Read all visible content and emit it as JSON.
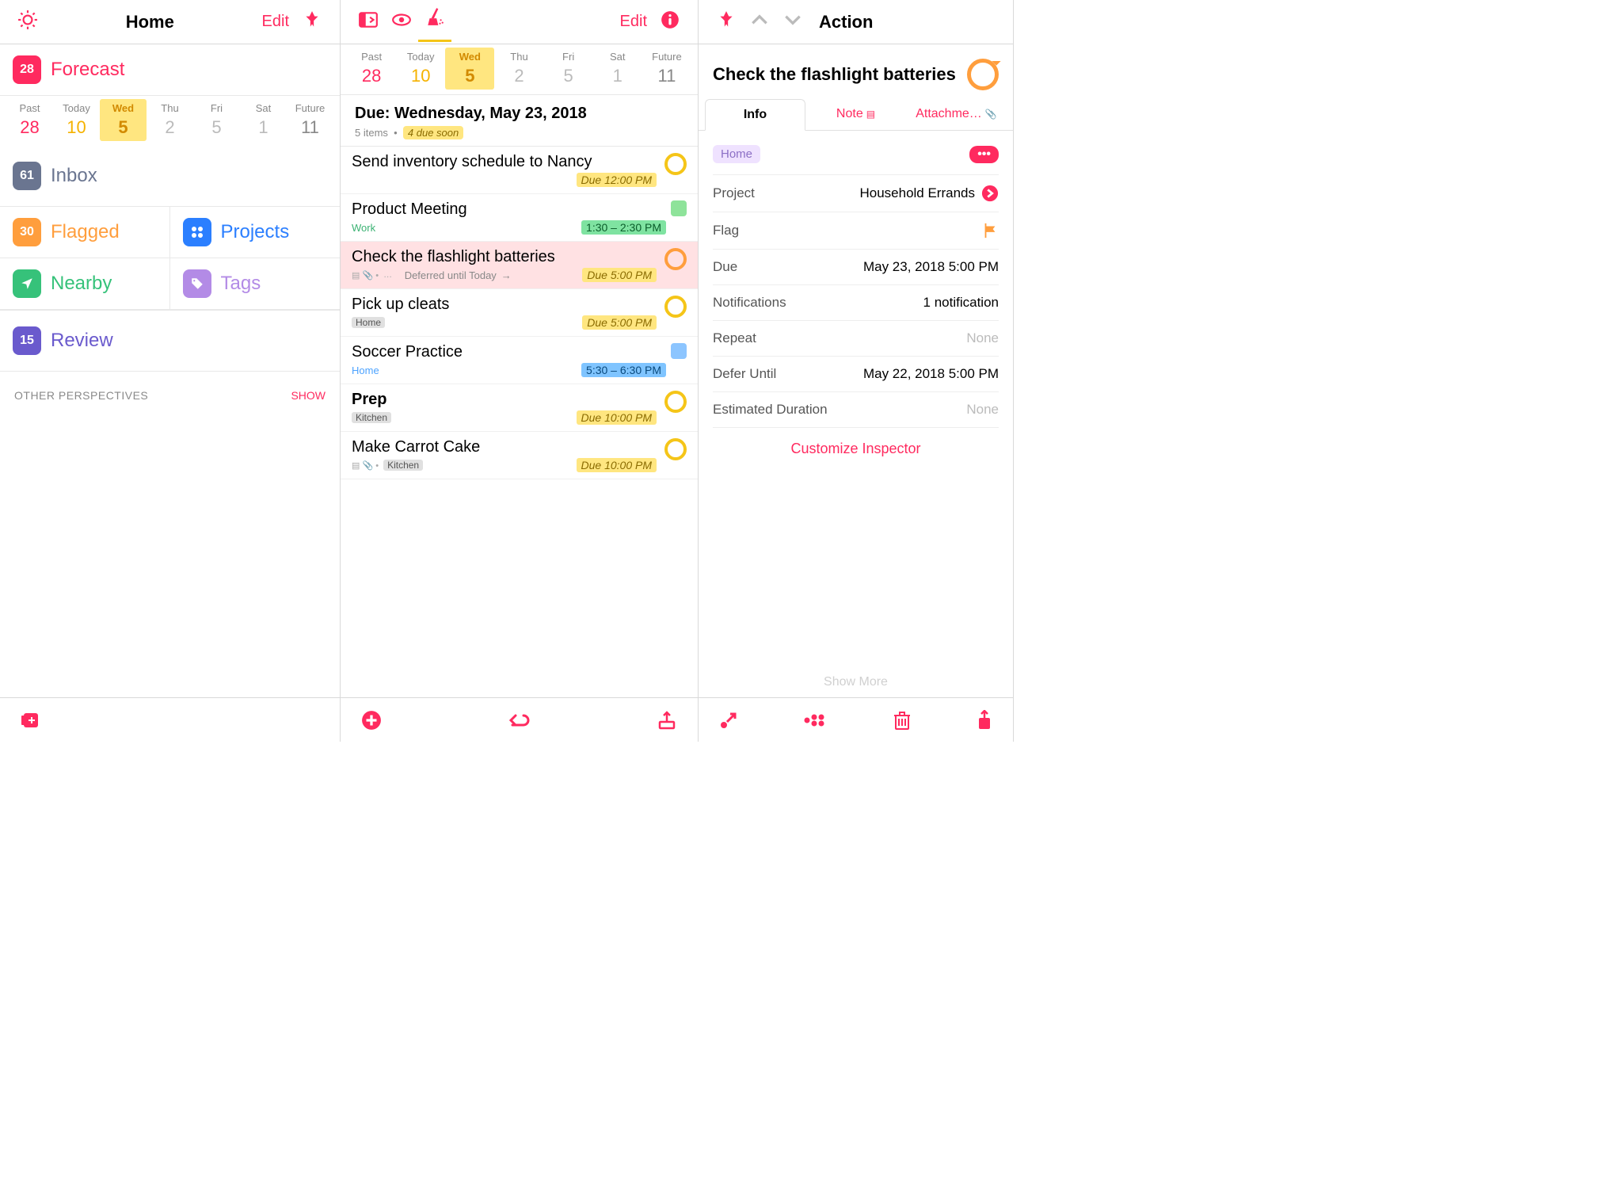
{
  "left": {
    "title": "Home",
    "edit": "Edit",
    "forecast": {
      "num": "28",
      "label": "Forecast"
    },
    "days": [
      {
        "lbl": "Past",
        "num": "28",
        "cls": "past"
      },
      {
        "lbl": "Today",
        "num": "10",
        "cls": "today"
      },
      {
        "lbl": "Wed",
        "num": "5",
        "cls": "sel"
      },
      {
        "lbl": "Thu",
        "num": "2",
        "cls": ""
      },
      {
        "lbl": "Fri",
        "num": "5",
        "cls": ""
      },
      {
        "lbl": "Sat",
        "num": "1",
        "cls": ""
      },
      {
        "lbl": "Future",
        "num": "11",
        "cls": "future"
      }
    ],
    "inbox": {
      "num": "61",
      "label": "Inbox"
    },
    "flagged": {
      "num": "30",
      "label": "Flagged"
    },
    "projects": {
      "label": "Projects"
    },
    "nearby": {
      "label": "Nearby"
    },
    "tags": {
      "label": "Tags"
    },
    "review": {
      "num": "15",
      "label": "Review"
    },
    "other_label": "OTHER PERSPECTIVES",
    "show": "SHOW"
  },
  "mid": {
    "edit": "Edit",
    "days": [
      {
        "lbl": "Past",
        "num": "28",
        "cls": "past"
      },
      {
        "lbl": "Today",
        "num": "10",
        "cls": "today"
      },
      {
        "lbl": "Wed",
        "num": "5",
        "cls": "sel"
      },
      {
        "lbl": "Thu",
        "num": "2",
        "cls": ""
      },
      {
        "lbl": "Fri",
        "num": "5",
        "cls": ""
      },
      {
        "lbl": "Sat",
        "num": "1",
        "cls": ""
      },
      {
        "lbl": "Future",
        "num": "11",
        "cls": "future"
      }
    ],
    "header_title": "Due: Wednesday, May 23, 2018",
    "header_count": "5 items",
    "header_due": "4 due soon",
    "tasks": [
      {
        "title": "Send inventory schedule to Nancy",
        "sub": "",
        "due": "Due 12:00 PM",
        "dueCls": "due-yel",
        "circle": "",
        "tagTxt": "",
        "tagCls": ""
      },
      {
        "title": "Product Meeting",
        "sub": "Work",
        "subCls": "tag-green",
        "due": "1:30 – 2:30 PM",
        "dueCls": "time-grn",
        "cal": "cal-green"
      },
      {
        "title": "Check the flashlight batteries",
        "selected": true,
        "meta": true,
        "defer": "Deferred until Today",
        "due": "Due 5:00 PM",
        "dueCls": "due-yel",
        "circle": "orange"
      },
      {
        "title": "Pick up cleats",
        "tagTxt": "Home",
        "tagCls": "tag-gray",
        "due": "Due 5:00 PM",
        "dueCls": "due-yel"
      },
      {
        "title": "Soccer Practice",
        "sub": "Home",
        "subCls": "tag-blue",
        "due": "5:30 – 6:30 PM",
        "dueCls": "time-blu",
        "cal": "cal-blue"
      },
      {
        "title": "Prep",
        "group": true,
        "tagTxt": "Kitchen",
        "tagCls": "tag-gray",
        "due": "Due 10:00 PM",
        "dueCls": "due-yel"
      },
      {
        "title": "Make Carrot Cake",
        "meta": true,
        "tagTxt": "Kitchen",
        "tagCls": "tag-gray",
        "due": "Due 10:00 PM",
        "dueCls": "due-yel"
      }
    ]
  },
  "right": {
    "toolbar_title": "Action",
    "title": "Check the flashlight batteries",
    "tabs": {
      "info": "Info",
      "note": "Note",
      "attach": "Attachme…"
    },
    "home_chip": "Home",
    "rows": {
      "project_k": "Project",
      "project_v": "Household Errands",
      "flag_k": "Flag",
      "due_k": "Due",
      "due_v": "May 23, 2018  5:00 PM",
      "notif_k": "Notifications",
      "notif_v": "1 notification",
      "repeat_k": "Repeat",
      "repeat_v": "None",
      "defer_k": "Defer Until",
      "defer_v": "May 22, 2018  5:00 PM",
      "est_k": "Estimated Duration",
      "est_v": "None"
    },
    "customize": "Customize Inspector",
    "show_more": "Show More"
  }
}
